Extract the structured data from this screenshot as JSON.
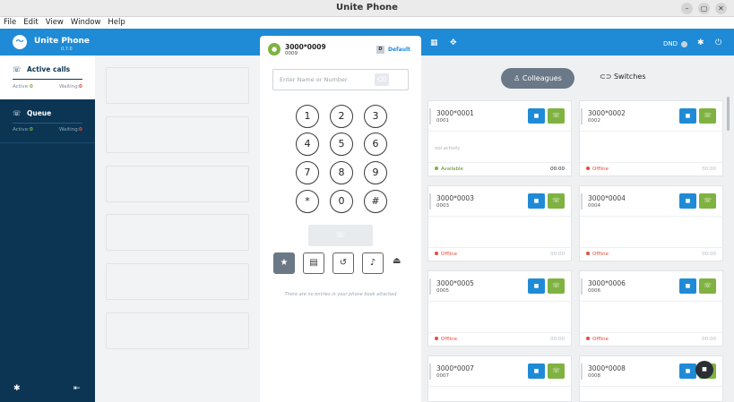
{
  "window": {
    "title": "Unite Phone"
  },
  "menu": [
    "File",
    "Edit",
    "View",
    "Window",
    "Help"
  ],
  "header": {
    "app_name": "Unite Phone",
    "version": "0.7.0",
    "dnd_label": "DND"
  },
  "sidebar": {
    "active_calls": {
      "title": "Active calls",
      "active_label": "Active:",
      "active_value": "0",
      "waiting_label": "Waiting:",
      "waiting_value": "0"
    },
    "queue": {
      "title": "Queue",
      "active_label": "Active:",
      "active_value": "0",
      "waiting_label": "Waiting:",
      "waiting_value": "0"
    }
  },
  "dialer": {
    "user_name": "3000*0009",
    "user_ext": "0009",
    "default_badge": "D",
    "default_label": "Default",
    "number_placeholder": "Enter Name or Number",
    "keys": [
      "1",
      "2",
      "3",
      "4",
      "5",
      "6",
      "7",
      "8",
      "9",
      "*",
      "0",
      "#"
    ],
    "empty_phonebook": "There are no entries in your phone book attached"
  },
  "tabs": {
    "colleagues": "Colleagues",
    "switches": "Switches"
  },
  "colors": {
    "accent": "#1f8bd6",
    "green": "#7fb241",
    "sidebar": "#0b3553",
    "offline": "#e74c3c"
  },
  "colleagues": [
    {
      "name": "3000*0001",
      "ext": "0001",
      "activity": "not activity",
      "status": "Available",
      "time": "00:00"
    },
    {
      "name": "3000*0002",
      "ext": "0002",
      "activity": "",
      "status": "Offline",
      "time": "00:00"
    },
    {
      "name": "3000*0003",
      "ext": "0003",
      "activity": "",
      "status": "Offline",
      "time": "00:00"
    },
    {
      "name": "3000*0004",
      "ext": "0004",
      "activity": "",
      "status": "Offline",
      "time": "00:00"
    },
    {
      "name": "3000*0005",
      "ext": "0005",
      "activity": "",
      "status": "Offline",
      "time": "00:00"
    },
    {
      "name": "3000*0006",
      "ext": "0006",
      "activity": "",
      "status": "Offline",
      "time": "00:00"
    },
    {
      "name": "3000*0007",
      "ext": "0007",
      "activity": "",
      "status": "",
      "time": ""
    },
    {
      "name": "3000*0008",
      "ext": "0008",
      "activity": "",
      "status": "",
      "time": ""
    }
  ]
}
